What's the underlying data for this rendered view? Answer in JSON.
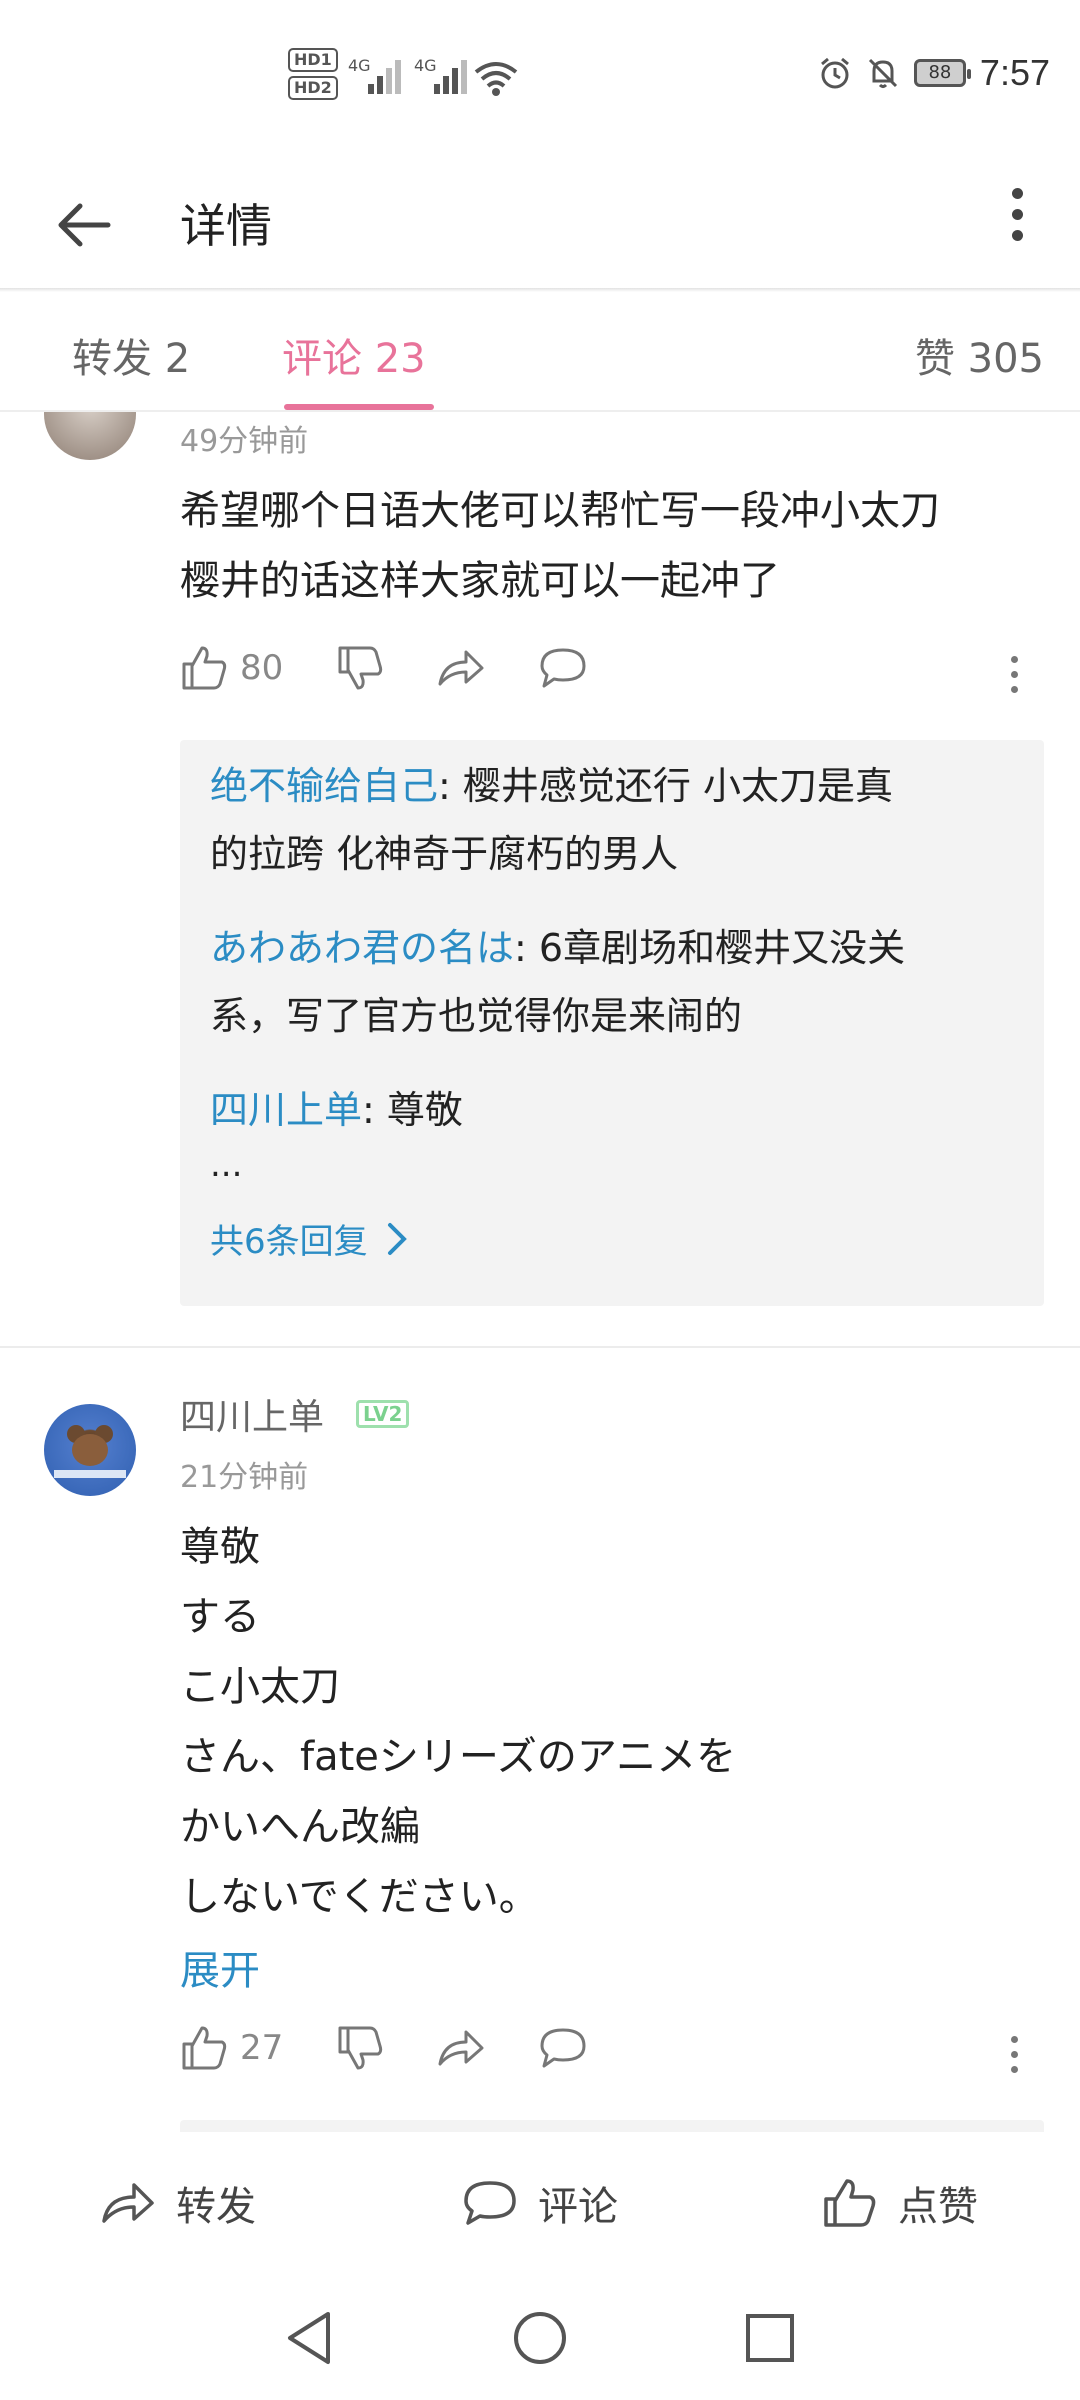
{
  "status_bar": {
    "hd1": "HD1",
    "hd2": "HD2",
    "sig1": "4G",
    "sig2": "4G",
    "battery": "88",
    "time": "7:57"
  },
  "app_bar": {
    "title": "详情"
  },
  "tabs": {
    "repost": "转发 2",
    "comments": "评论 23",
    "likes": "赞 305"
  },
  "comment1": {
    "time": "49分钟前",
    "text_line1": "希望哪个日语大佬可以帮忙写一段冲小太刀",
    "text_line2": "樱井的话这样大家就可以一起冲了",
    "like_count": "80",
    "replies": [
      {
        "who": "绝不输给自己",
        "text_line1": ": 樱井感觉还行 小太刀是真",
        "text_line2": "的拉跨 化神奇于腐朽的男人"
      },
      {
        "who": "あわあわ君の名は",
        "text_line1": ": 6章剧场和樱井又没关",
        "text_line2": "系，写了官方也觉得你是来闹的"
      },
      {
        "who": "四川上单",
        "text_line1": ": 尊敬",
        "text_line2": ""
      }
    ],
    "ellipsis": "...",
    "more_replies": "共6条回复"
  },
  "comment2": {
    "username": "四川上单",
    "level": "LV2",
    "time": "21分钟前",
    "lines": [
      "尊敬",
      "する",
      "こ小太刀",
      "さん、fateシリーズのアニメを",
      "かいへん改編",
      "しないでください。"
    ],
    "expand": "展开",
    "like_count": "27"
  },
  "bottom_bar": {
    "repost": "转发",
    "comment": "评论",
    "like": "点赞"
  }
}
